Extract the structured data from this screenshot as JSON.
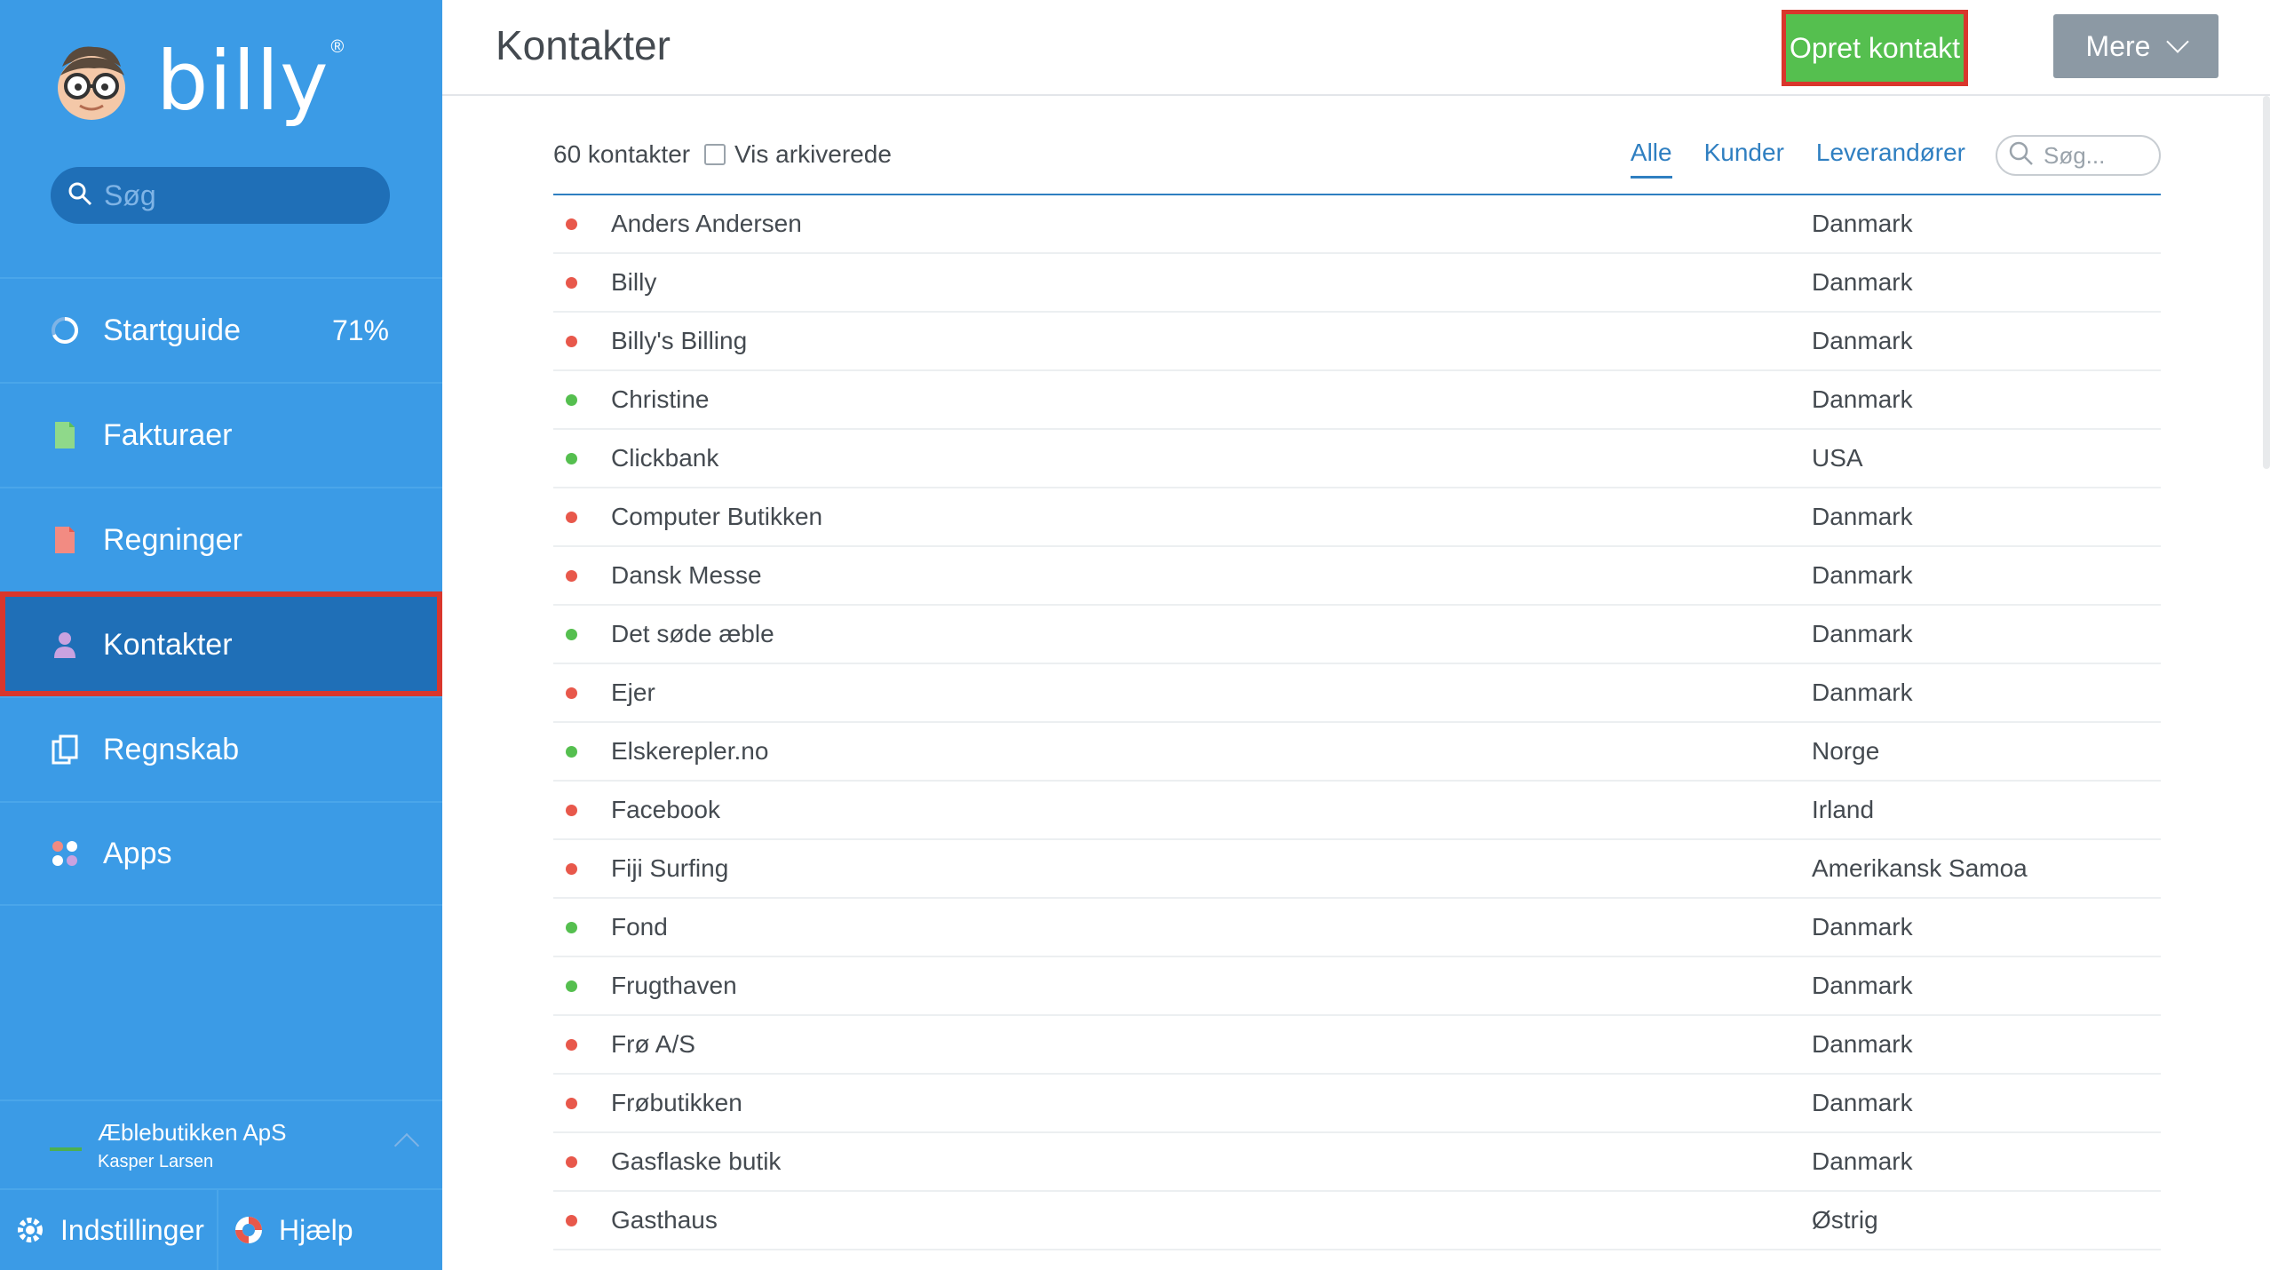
{
  "brand": {
    "name": "billy",
    "reg": "®"
  },
  "sidebar": {
    "search_placeholder": "Søg",
    "items": [
      {
        "label": "Startguide",
        "pct": "71%"
      },
      {
        "label": "Fakturaer"
      },
      {
        "label": "Regninger"
      },
      {
        "label": "Kontakter"
      },
      {
        "label": "Regnskab"
      },
      {
        "label": "Apps"
      }
    ],
    "company": {
      "name": "Æblebutikken ApS",
      "user": "Kasper Larsen"
    },
    "bottom": {
      "settings": "Indstillinger",
      "help": "Hjælp"
    }
  },
  "header": {
    "title": "Kontakter",
    "create_label": "Opret kontakt",
    "more_label": "Mere"
  },
  "toolbar": {
    "count": "60 kontakter",
    "show_archived": "Vis arkiverede",
    "filters": [
      "Alle",
      "Kunder",
      "Leverandører"
    ],
    "search_placeholder": "Søg..."
  },
  "colors": {
    "red": "#e8584b",
    "green": "#55bf4f",
    "sidebar": "#3b9be6",
    "accent": "#2f7fc1"
  },
  "contacts": [
    {
      "name": "Anders Andersen",
      "country": "Danmark",
      "status": "red"
    },
    {
      "name": "Billy",
      "country": "Danmark",
      "status": "red"
    },
    {
      "name": "Billy's Billing",
      "country": "Danmark",
      "status": "red"
    },
    {
      "name": "Christine",
      "country": "Danmark",
      "status": "green"
    },
    {
      "name": "Clickbank",
      "country": "USA",
      "status": "green"
    },
    {
      "name": "Computer Butikken",
      "country": "Danmark",
      "status": "red"
    },
    {
      "name": "Dansk Messe",
      "country": "Danmark",
      "status": "red"
    },
    {
      "name": "Det søde æble",
      "country": "Danmark",
      "status": "green"
    },
    {
      "name": "Ejer",
      "country": "Danmark",
      "status": "red"
    },
    {
      "name": "Elskerepler.no",
      "country": "Norge",
      "status": "green"
    },
    {
      "name": "Facebook",
      "country": "Irland",
      "status": "red"
    },
    {
      "name": "Fiji Surfing",
      "country": "Amerikansk Samoa",
      "status": "red"
    },
    {
      "name": "Fond",
      "country": "Danmark",
      "status": "green"
    },
    {
      "name": "Frugthaven",
      "country": "Danmark",
      "status": "green"
    },
    {
      "name": "Frø A/S",
      "country": "Danmark",
      "status": "red"
    },
    {
      "name": "Frøbutikken",
      "country": "Danmark",
      "status": "red"
    },
    {
      "name": "Gasflaske butik",
      "country": "Danmark",
      "status": "red"
    },
    {
      "name": "Gasthaus",
      "country": "Østrig",
      "status": "red"
    }
  ]
}
